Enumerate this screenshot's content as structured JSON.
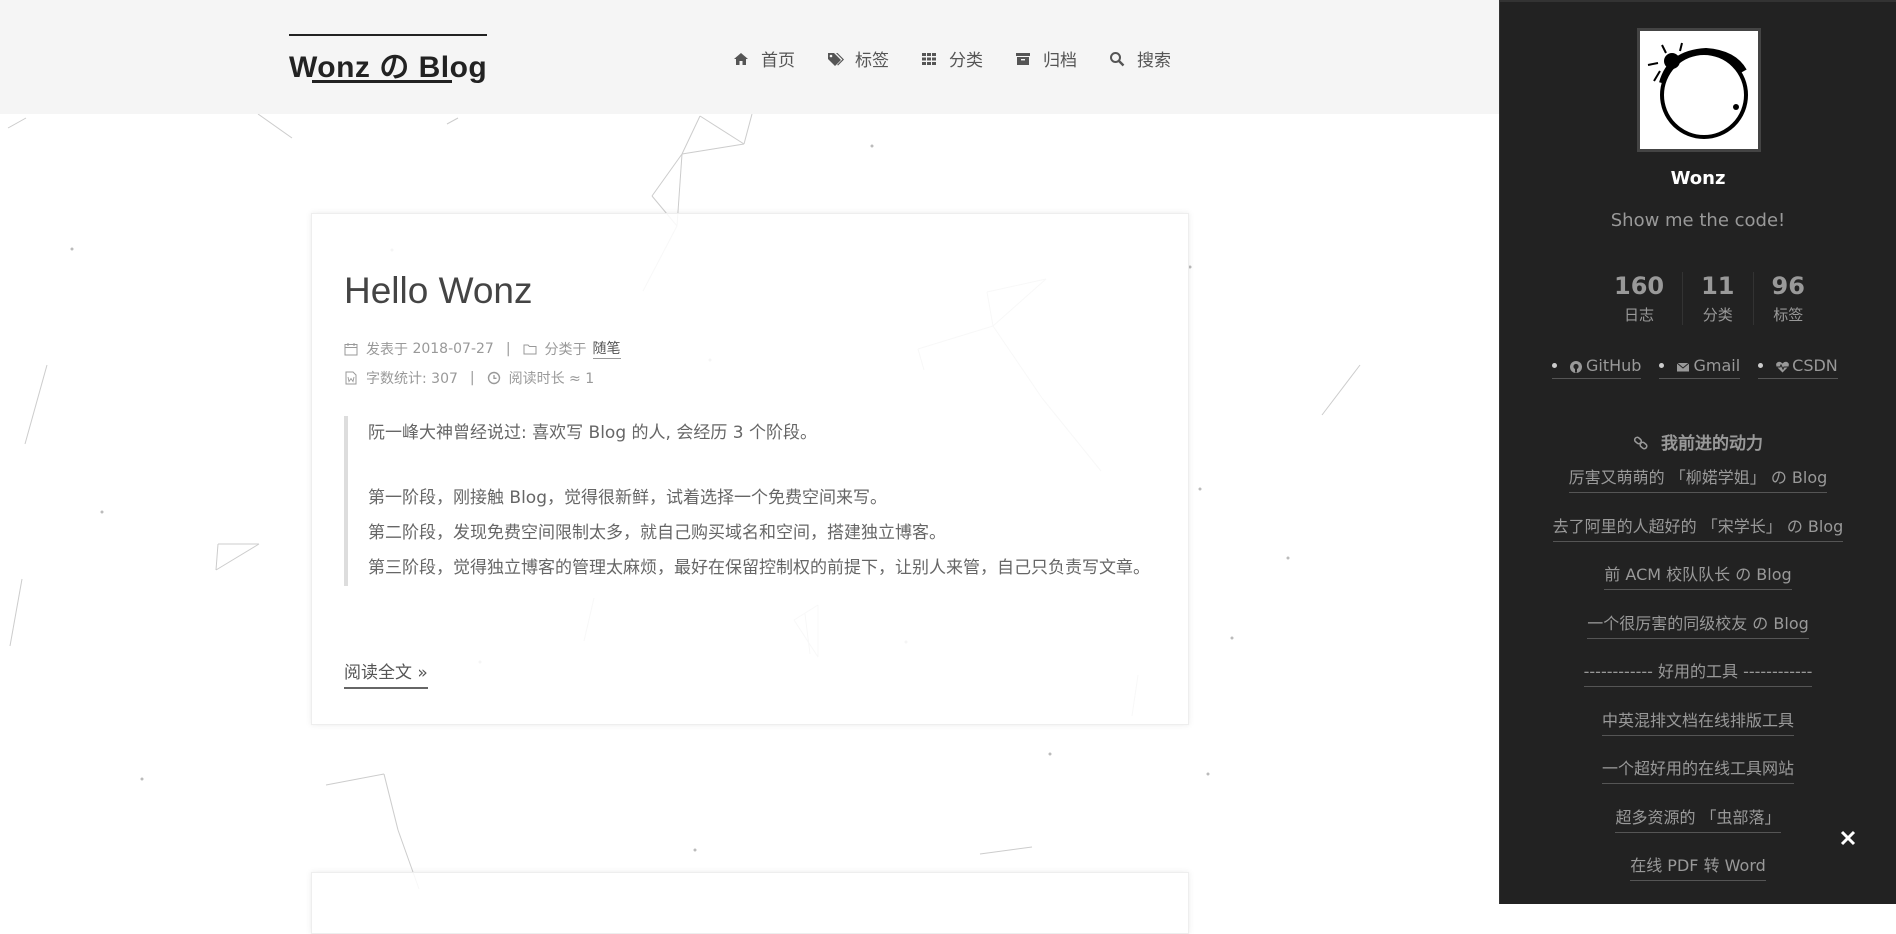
{
  "header": {
    "logo": "Wonz の Blog",
    "nav": [
      {
        "label": "首页",
        "icon": "home-icon"
      },
      {
        "label": "标签",
        "icon": "tags-icon"
      },
      {
        "label": "分类",
        "icon": "grid-icon"
      },
      {
        "label": "归档",
        "icon": "archive-icon"
      },
      {
        "label": "搜索",
        "icon": "search-icon"
      }
    ]
  },
  "post": {
    "title": "Hello Wonz",
    "posted_label": "发表于",
    "date": "2018-07-27",
    "category_label": "分类于",
    "category": "随笔",
    "wordcount_label": "字数统计: 307",
    "readtime_label": "阅读时长 ≈ 1",
    "quote": [
      "阮一峰大神曾经说过: 喜欢写 Blog 的人, 会经历 3 个阶段。",
      "第一阶段，刚接触 Blog，觉得很新鲜，试着选择一个免费空间来写。",
      "第二阶段，发现免费空间限制太多，就自己购买域名和空间，搭建独立博客。",
      "第三阶段，觉得独立博客的管理太麻烦，最好在保留控制权的前提下，让别人来管，自己只负责写文章。"
    ],
    "read_more": "阅读全文 »"
  },
  "sidebar": {
    "author": "Wonz",
    "motto": "Show me the code!",
    "stats": [
      {
        "num": "160",
        "label": "日志"
      },
      {
        "num": "11",
        "label": "分类"
      },
      {
        "num": "96",
        "label": "标签"
      }
    ],
    "social": [
      {
        "label": "GitHub",
        "icon": "github-icon"
      },
      {
        "label": "Gmail",
        "icon": "envelope-icon"
      },
      {
        "label": "CSDN",
        "icon": "heartbeat-icon"
      }
    ],
    "links_title": "我前进的动力",
    "links": [
      "厉害又萌萌的 「柳婼学姐」 の Blog",
      "去了阿里的人超好的 「宋学长」 の Blog",
      "前 ACM 校队队长 の Blog",
      "一个很厉害的同级校友 の Blog",
      "------------ 好用的工具 ------------",
      "中英混排文档在线排版工具",
      "一个超好用的在线工具网站",
      "超多资源的 「虫部落」",
      "在线 PDF 转 Word"
    ]
  },
  "colors": {
    "header_bg": "#f5f5f5",
    "sidebar_bg": "#222222",
    "text": "#555555"
  }
}
